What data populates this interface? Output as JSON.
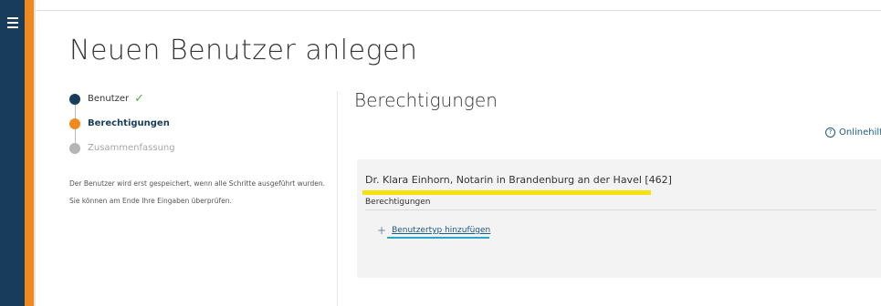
{
  "header": {
    "title": "Neuen Benutzer anlegen"
  },
  "steps": [
    {
      "label": "Benutzer",
      "state": "done",
      "check": "✓"
    },
    {
      "label": "Berechtigungen",
      "state": "active"
    },
    {
      "label": "Zusammenfassung",
      "state": "todo"
    }
  ],
  "info": {
    "line1": "Der Benutzer wird erst gespeichert, wenn alle Schritte ausgeführt wurden.",
    "line2": "Sie können am Ende Ihre Eingaben überprüfen."
  },
  "section": {
    "title": "Berechtigungen",
    "help_label": "Onlinehilfe",
    "help_icon": "?"
  },
  "panel": {
    "notary": "Dr. Klara Einhorn, Notarin in Brandenburg an der Havel [462]",
    "perm_label": "Berechtigungen",
    "add_label": "Benutzertyp hinzufügen",
    "add_icon": "+"
  },
  "colors": {
    "sidebar": "#173c5c",
    "accent": "#f08a1d",
    "link": "#1c5b82",
    "highlight": "#f5e20a"
  }
}
